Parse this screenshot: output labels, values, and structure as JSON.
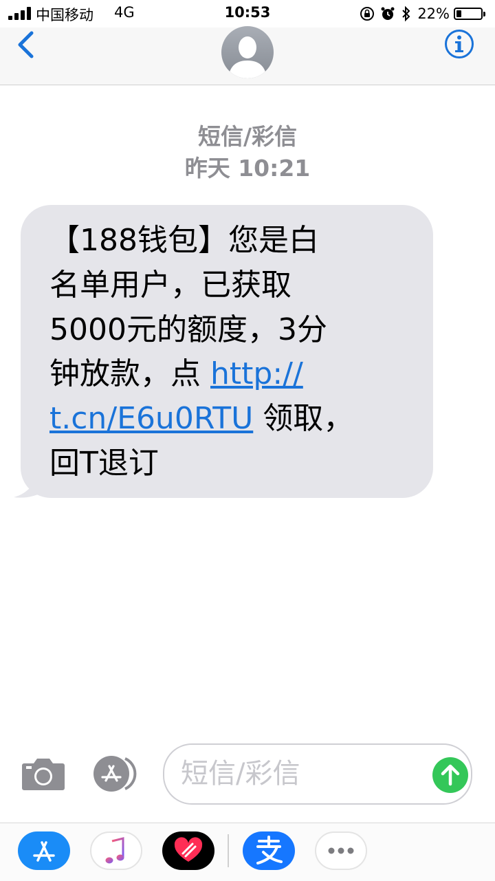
{
  "status_bar": {
    "carrier": "中国移动",
    "network": "4G",
    "time": "10:53",
    "battery_percent": "22%",
    "battery_level": 0.22,
    "icons": [
      "orientation-lock-icon",
      "alarm-icon",
      "bluetooth-icon"
    ]
  },
  "nav": {
    "back_icon": "chevron-left-icon",
    "avatar_icon": "person-silhouette-icon",
    "info_icon": "info-icon",
    "accent_color": "#1a73d9"
  },
  "conversation": {
    "kind": "短信/彩信",
    "timestamp": "昨天 10:21"
  },
  "message": {
    "text_before_link": "【188钱包】您是白\n名单用户，已获取\n5000元的额度，3分\n钟放款，点 ",
    "link": "http://\nt.cn/E6u0RTU",
    "text_after_link": " 领取，\n回T退订"
  },
  "composer": {
    "placeholder": "短信/彩信",
    "camera_icon": "camera-icon",
    "appstore_icon": "app-store-icon",
    "send_icon": "send-arrow-icon",
    "send_color": "#34c759"
  },
  "app_drawer": {
    "apps": [
      "app-store-icon",
      "music-icon",
      "digital-touch-icon",
      "alipay-icon",
      "more-icon"
    ]
  }
}
